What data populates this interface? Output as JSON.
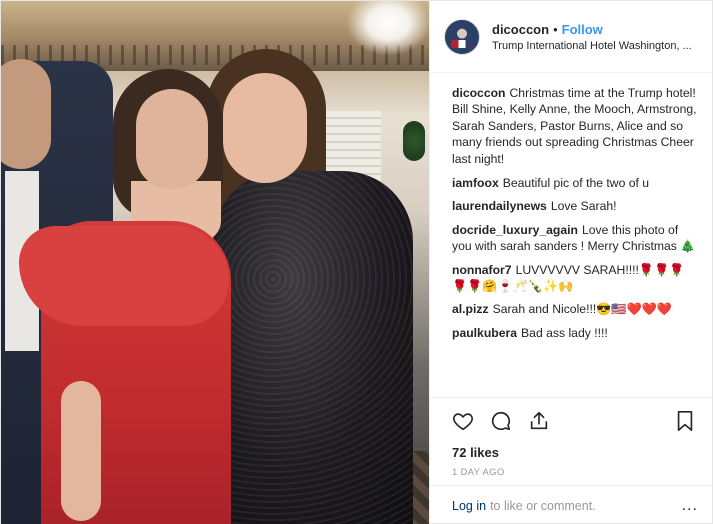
{
  "header": {
    "username": "dicoccon",
    "separator": "•",
    "follow_label": "Follow",
    "location": "Trump International Hotel Washington, ..."
  },
  "caption": {
    "username": "dicoccon",
    "text": "Christmas time at the Trump hotel! Bill Shine, Kelly Anne, the Mooch, Armstrong, Sarah Sanders, Pastor Burns, Alice and so many friends out spreading Christmas Cheer last night!"
  },
  "comments": [
    {
      "username": "iamfoox",
      "text": "Beautiful pic of the two of u"
    },
    {
      "username": "laurendailynews",
      "text": "Love Sarah!"
    },
    {
      "username": "docride_luxury_again",
      "text": "Love this photo of you with sarah sanders ! Merry Christmas 🎄"
    },
    {
      "username": "nonnafor7",
      "text": "LUVVVVVV SARAH!!!!🌹🌹🌹🌹🌹🤗🍷🥂🍾✨🙌"
    },
    {
      "username": "al.pizz",
      "text": "Sarah and Nicole!!!😎🇺🇸❤️❤️❤️"
    },
    {
      "username": "paulkubera",
      "text": "Bad ass lady !!!!"
    }
  ],
  "actions": {
    "like_icon": "heart-icon",
    "comment_icon": "comment-icon",
    "share_icon": "share-icon",
    "save_icon": "bookmark-icon"
  },
  "likes": "72 likes",
  "time_ago": "1 DAY AGO",
  "footer": {
    "login_label": "Log in",
    "login_rest": "to like or comment.",
    "more_label": "..."
  },
  "colors": {
    "link_blue": "#3897f0",
    "login_blue": "#003569",
    "muted": "#999999",
    "text": "#262626"
  }
}
